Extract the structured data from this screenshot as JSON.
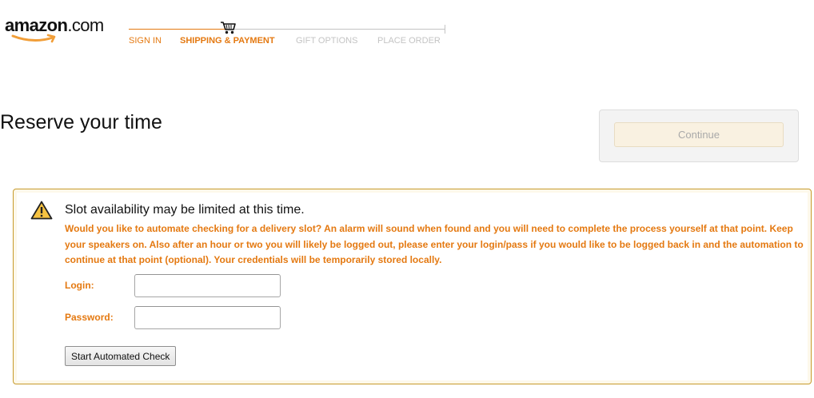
{
  "header": {
    "logo_text": "amazon",
    "logo_suffix": ".com",
    "logo_icon": "amazon-smile-icon"
  },
  "checkout_progress": {
    "cart_icon": "cart-icon",
    "steps": [
      {
        "label": "SIGN IN",
        "state": "complete"
      },
      {
        "label": "SHIPPING & PAYMENT",
        "state": "current"
      },
      {
        "label": "GIFT OPTIONS",
        "state": "pending"
      },
      {
        "label": "PLACE ORDER",
        "state": "pending"
      }
    ]
  },
  "main": {
    "title": "Reserve your time",
    "continue_label": "Continue"
  },
  "alert": {
    "icon": "warning-icon",
    "heading": "Slot availability may be limited at this time.",
    "message": "Would you like to automate checking for a delivery slot? An alarm will sound when found and you will need to complete the process yourself at that point. Keep your speakers on. Also after an hour or two you will likely be logged out, please enter your login/pass if you would like to be logged back in and the automation to continue at that point (optional). Your credentials will be temporarily stored locally.",
    "login_label": "Login:",
    "login_value": "",
    "password_label": "Password:",
    "password_value": "",
    "start_button_label": "Start Automated Check"
  },
  "colors": {
    "accent_orange": "#e47911",
    "inactive_gray": "#c4c4c4",
    "alert_border": "#c79b2b",
    "continue_bg": "#f9f1e1"
  }
}
